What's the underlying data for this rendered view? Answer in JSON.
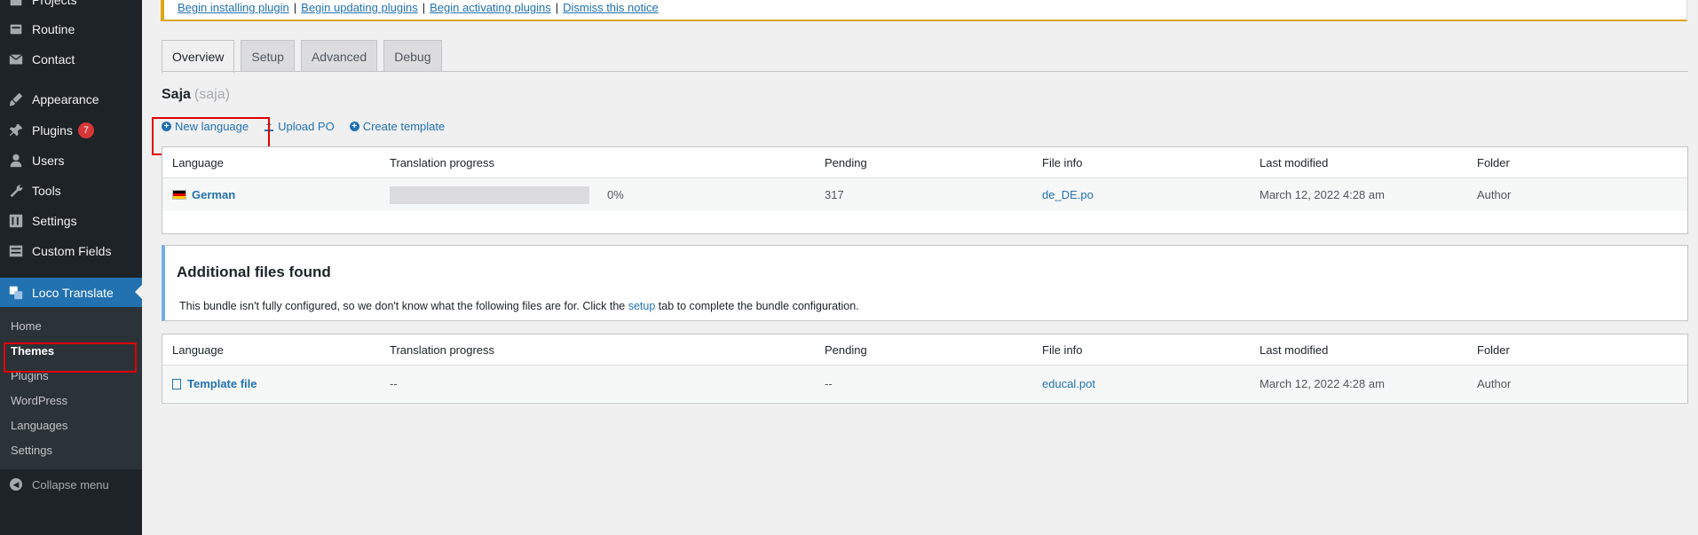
{
  "sidebar": {
    "items": [
      {
        "label": "Projects",
        "icon": "projects-icon"
      },
      {
        "label": "Routine",
        "icon": "routine-icon"
      },
      {
        "label": "Contact",
        "icon": "mail-icon"
      },
      {
        "label": "Appearance",
        "icon": "paintbrush-icon"
      },
      {
        "label": "Plugins",
        "icon": "plugin-icon",
        "badge": "7"
      },
      {
        "label": "Users",
        "icon": "users-icon"
      },
      {
        "label": "Tools",
        "icon": "wrench-icon"
      },
      {
        "label": "Settings",
        "icon": "settings-icon"
      },
      {
        "label": "Custom Fields",
        "icon": "custom-fields-icon"
      },
      {
        "label": "Loco Translate",
        "icon": "translate-icon"
      }
    ],
    "submenu": [
      "Home",
      "Themes",
      "Plugins",
      "WordPress",
      "Languages",
      "Settings"
    ],
    "collapse_label": "Collapse menu"
  },
  "notice": {
    "links": [
      "Begin installing plugin",
      "Begin updating plugins",
      "Begin activating plugins",
      "Dismiss this notice"
    ],
    "separator": "|"
  },
  "tabs": [
    "Overview",
    "Setup",
    "Advanced",
    "Debug"
  ],
  "bundle": {
    "name": "Saja",
    "slug": "(saja)"
  },
  "actions": [
    "New language",
    "Upload PO",
    "Create template"
  ],
  "table_headers": [
    "Language",
    "Translation progress",
    "Pending",
    "File info",
    "Last modified",
    "Folder"
  ],
  "translations": [
    {
      "language": "German",
      "progress_percent": 0,
      "progress_label": "0%",
      "pending": "317",
      "file": "de_DE.po",
      "modified": "March 12, 2022 4:28 am",
      "folder": "Author"
    }
  ],
  "callout": {
    "title": "Additional files found",
    "text_before": "This bundle isn't fully configured, so we don't know what the following files are for. Click the ",
    "link": "setup",
    "text_after": " tab to complete the bundle configuration."
  },
  "templates": [
    {
      "language": "Template file",
      "progress": "--",
      "pending": "--",
      "file": "educal.pot",
      "modified": "March 12, 2022 4:28 am",
      "folder": "Author"
    }
  ],
  "colors": {
    "accent": "#2271b1",
    "sidebar_bg": "#1d2327",
    "notice_border": "#dba617",
    "highlight": "#e00000",
    "badge": "#d63638"
  }
}
